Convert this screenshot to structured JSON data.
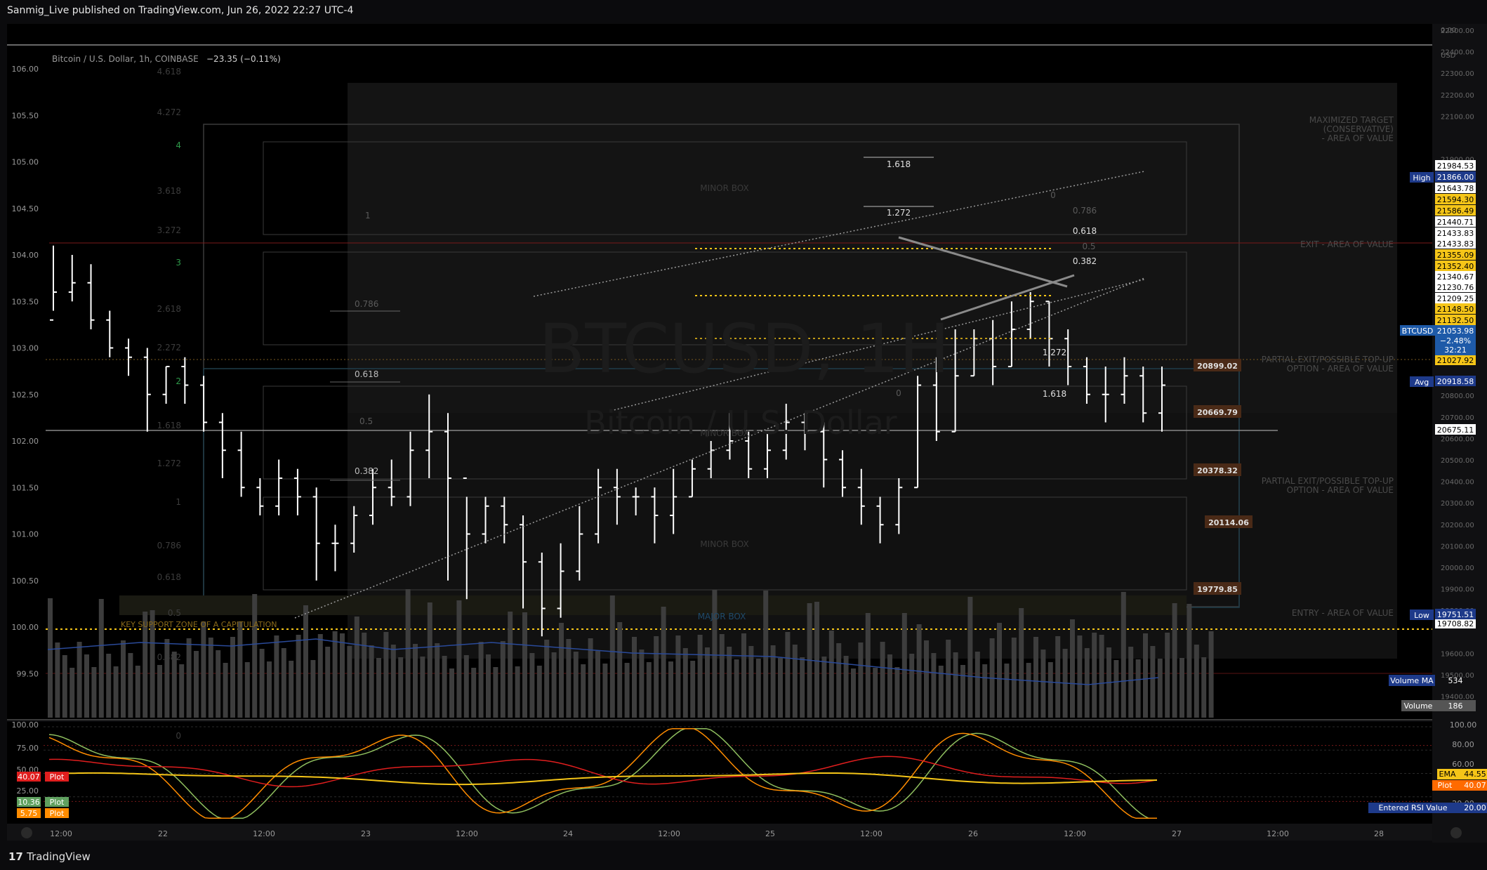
{
  "header": {
    "published": "Sanmig_Live published on TradingView.com, Jun 26, 2022 22:27 UTC-4"
  },
  "footer": {
    "brand_mark": "17",
    "brand_name": "TradingView"
  },
  "legend": {
    "symbol": "Bitcoin / U.S. Dollar, 1h, COINBASE",
    "change": "−23.35 (−0.11%)"
  },
  "watermark": {
    "ticker": "BTCUSD, 1H",
    "name": "Bitcoin / U.S. Dollar"
  },
  "colors": {
    "bg": "#000000",
    "candle": "#ffffff",
    "ema": "#f5c518",
    "plot_red": "#e01e1e",
    "plot_orange": "#ff8c00",
    "plot_green": "#8fbf5f",
    "accent_blue": "#1e3a8a",
    "box_label": "#4a2a17"
  },
  "chart_data": {
    "type": "candlestick",
    "xlabels": [
      "12:00",
      "22",
      "12:00",
      "23",
      "12:00",
      "24",
      "12:00",
      "25",
      "12:00",
      "26",
      "12:00",
      "27",
      "12:00",
      "28"
    ],
    "left_axis": [
      "106.00",
      "105.50",
      "105.00",
      "104.50",
      "104.00",
      "103.50",
      "103.00",
      "102.50",
      "102.00",
      "101.50",
      "101.00",
      "100.50",
      "100.00",
      "99.50"
    ],
    "right_axis": [
      "0.00",
      "USD",
      "22500.00",
      "22400.00",
      "22300.00",
      "22200.00",
      "22100.00",
      "21900.00",
      "20800.00",
      "20700.00",
      "20600.00",
      "20500.00",
      "20400.00",
      "20300.00",
      "20200.00",
      "20100.00",
      "20000.00",
      "19900.00",
      "19800.00",
      "19600.00",
      "19500.00",
      "19400.00"
    ],
    "right_axis_values": [
      0,
      0,
      22500,
      22400,
      22300,
      22200,
      22100,
      21900,
      20800,
      20700,
      20600,
      20500,
      20400,
      20300,
      20200,
      20100,
      20000,
      19900,
      19800,
      19600,
      19500,
      19400
    ],
    "right_price_labels": [
      {
        "text": "21984.53",
        "style": "white",
        "price": 21984.53
      },
      {
        "text": "21643.78",
        "style": "white",
        "price": 21643.78
      },
      {
        "text": "21594.30",
        "style": "yellow",
        "price": 21594.3
      },
      {
        "text": "21586.49",
        "style": "yellow",
        "price": 21586.49
      },
      {
        "text": "21440.71",
        "style": "white",
        "price": 21440.71
      },
      {
        "text": "21433.83",
        "style": "white",
        "price": 21433.83
      },
      {
        "text": "21433.83",
        "style": "white",
        "price": 21433.83
      },
      {
        "text": "21355.09",
        "style": "yellow",
        "price": 21355.09
      },
      {
        "text": "21352.40",
        "style": "yellow",
        "price": 21352.4
      },
      {
        "text": "21340.67",
        "style": "white",
        "price": 21340.67
      },
      {
        "text": "21230.76",
        "style": "white",
        "price": 21230.76
      },
      {
        "text": "21209.25",
        "style": "white",
        "price": 21209.25
      },
      {
        "text": "21148.50",
        "style": "yellow",
        "price": 21148.5
      },
      {
        "text": "21132.50",
        "style": "yellow",
        "price": 21132.5
      },
      {
        "text": "21027.92",
        "style": "yellow",
        "price": 21027.92
      },
      {
        "text": "20675.11",
        "style": "white",
        "price": 20675.11
      },
      {
        "text": "19708.82",
        "style": "white",
        "price": 19708.82
      }
    ],
    "stats": {
      "high_label": "High",
      "high": "21866.00",
      "low_label": "Low",
      "low": "19751.51",
      "avg_label": "Avg",
      "avg": "20918.58",
      "symbol_tag": "BTCUSD",
      "last": "21053.98",
      "change_pct": "−2.48%",
      "countdown": "32:21"
    },
    "box_labels": [
      "20899.02",
      "20669.79",
      "20378.32",
      "20114.06",
      "19779.85"
    ],
    "annotations": {
      "max_target": [
        "MAXIMIZED TARGET",
        "(CONSERVATIVE)",
        "- AREA OF VALUE"
      ],
      "exit": "EXIT - AREA OF VALUE",
      "partial_1": [
        "PARTIAL EXIT/POSSIBLE TOP-UP",
        "OPTION - AREA OF VALUE"
      ],
      "partial_2": [
        "PARTIAL EXIT/POSSIBLE TOP-UP",
        "OPTION - AREA OF VALUE"
      ],
      "entry": "ENTRY - AREA OF VALUE",
      "support": "KEY SUPPORT ZONE OF A CAPITULATION",
      "minor_box": "MINOR BOX",
      "major_box": "MAJOR BOX"
    },
    "fib_left": [
      "4.618",
      "4.272",
      "4",
      "3.618",
      "3.272",
      "3",
      "2.618",
      "2.272",
      "2",
      "1.618",
      "1.272",
      "1",
      "0.786",
      "0.618",
      "0.5",
      "0.382",
      "0"
    ],
    "fib_mid": [
      "1",
      "0.786",
      "0.618",
      "0.5",
      "0.382"
    ],
    "fib_top": [
      "1.618",
      "1.272"
    ],
    "fib_right": [
      "0",
      "0.786",
      "0.618",
      "0.5",
      "0.382",
      "1.272",
      "1.618"
    ],
    "volume": {
      "ma_label": "Volume MA",
      "ma_value": "534",
      "label": "Volume",
      "value": "186"
    },
    "osc_axis": [
      "100.00",
      "75.00",
      "50.00",
      "25.00"
    ],
    "osc_axis_right": [
      "100.00",
      "80.00",
      "60.00",
      "40.00",
      "20.00"
    ],
    "osc_labels_left": [
      {
        "value": "40.07",
        "name": "Plot",
        "color": "#e01e1e"
      },
      {
        "value": "10.36",
        "name": "Plot",
        "color": "#5fa05f"
      },
      {
        "value": "5.75",
        "name": "Plot",
        "color": "#ff8c00"
      }
    ],
    "osc_labels_right": [
      {
        "name": "EMA",
        "value": "44.55",
        "color": "#f5c518"
      },
      {
        "name": "Plot",
        "value": "40.07",
        "color": "#ff6a00"
      },
      {
        "name": "Entered RSI Value",
        "value": "20.00",
        "color": "#1e3a8a"
      }
    ],
    "candles": [
      [
        103.3,
        103.6,
        103.4,
        104.1
      ],
      [
        103.6,
        103.7,
        103.5,
        104.0
      ],
      [
        103.7,
        103.3,
        103.2,
        103.9
      ],
      [
        103.3,
        103.0,
        102.9,
        103.4
      ],
      [
        103.0,
        102.9,
        102.7,
        103.1
      ],
      [
        102.9,
        102.5,
        102.1,
        103.0
      ],
      [
        102.5,
        102.8,
        102.4,
        102.8
      ],
      [
        102.8,
        102.6,
        102.4,
        102.9
      ],
      [
        102.6,
        102.2,
        102.1,
        102.7
      ],
      [
        102.2,
        101.9,
        101.6,
        102.3
      ],
      [
        101.9,
        101.5,
        101.4,
        102.1
      ],
      [
        101.5,
        101.3,
        101.2,
        101.6
      ],
      [
        101.3,
        101.6,
        101.2,
        101.8
      ],
      [
        101.6,
        101.4,
        101.2,
        101.7
      ],
      [
        101.4,
        100.9,
        100.5,
        101.5
      ],
      [
        100.9,
        100.9,
        100.6,
        101.1
      ],
      [
        100.9,
        101.2,
        100.8,
        101.3
      ],
      [
        101.2,
        101.5,
        101.1,
        101.7
      ],
      [
        101.5,
        101.4,
        101.3,
        101.8
      ],
      [
        101.4,
        101.9,
        101.3,
        102.1
      ],
      [
        101.9,
        102.1,
        101.6,
        102.5
      ],
      [
        102.1,
        101.6,
        100.5,
        102.3
      ],
      [
        101.6,
        101.0,
        100.3,
        101.4
      ],
      [
        101.0,
        101.3,
        100.9,
        101.4
      ],
      [
        101.3,
        101.1,
        100.9,
        101.4
      ],
      [
        101.1,
        100.7,
        100.2,
        101.2
      ],
      [
        100.7,
        100.2,
        99.9,
        100.8
      ],
      [
        100.2,
        100.6,
        100.1,
        100.9
      ],
      [
        100.6,
        101.0,
        100.5,
        101.3
      ],
      [
        101.0,
        101.5,
        100.9,
        101.7
      ],
      [
        101.5,
        101.4,
        101.1,
        101.7
      ],
      [
        101.4,
        101.4,
        101.2,
        101.5
      ],
      [
        101.4,
        101.2,
        100.9,
        101.5
      ],
      [
        101.2,
        101.4,
        101.0,
        101.7
      ],
      [
        101.4,
        101.7,
        101.4,
        101.8
      ],
      [
        101.7,
        101.9,
        101.6,
        102.0
      ],
      [
        101.9,
        102.0,
        101.8,
        102.3
      ],
      [
        102.0,
        101.7,
        101.6,
        102.1
      ],
      [
        101.7,
        101.9,
        101.6,
        102.1
      ],
      [
        101.9,
        102.2,
        101.8,
        102.4
      ],
      [
        102.2,
        102.1,
        101.9,
        102.3
      ],
      [
        102.1,
        101.8,
        101.5,
        102.2
      ],
      [
        101.8,
        101.5,
        101.4,
        101.9
      ],
      [
        101.5,
        101.3,
        101.1,
        101.7
      ],
      [
        101.3,
        101.1,
        100.9,
        101.4
      ],
      [
        101.1,
        101.5,
        101.0,
        101.6
      ],
      [
        101.5,
        102.6,
        101.5,
        102.7
      ],
      [
        102.6,
        102.1,
        102.0,
        102.9
      ],
      [
        102.1,
        102.7,
        102.1,
        103.2
      ],
      [
        102.7,
        103.1,
        102.7,
        103.2
      ],
      [
        103.1,
        102.8,
        102.6,
        103.3
      ],
      [
        102.8,
        103.2,
        102.8,
        103.5
      ],
      [
        103.2,
        103.5,
        103.1,
        103.6
      ],
      [
        103.5,
        103.1,
        102.8,
        103.5
      ],
      [
        103.1,
        102.8,
        102.6,
        103.2
      ],
      [
        102.8,
        102.5,
        102.4,
        102.9
      ],
      [
        102.5,
        102.5,
        102.2,
        102.8
      ],
      [
        102.5,
        102.7,
        102.4,
        102.9
      ],
      [
        102.7,
        102.3,
        102.2,
        102.8
      ],
      [
        102.3,
        102.6,
        102.1,
        102.8
      ]
    ]
  }
}
